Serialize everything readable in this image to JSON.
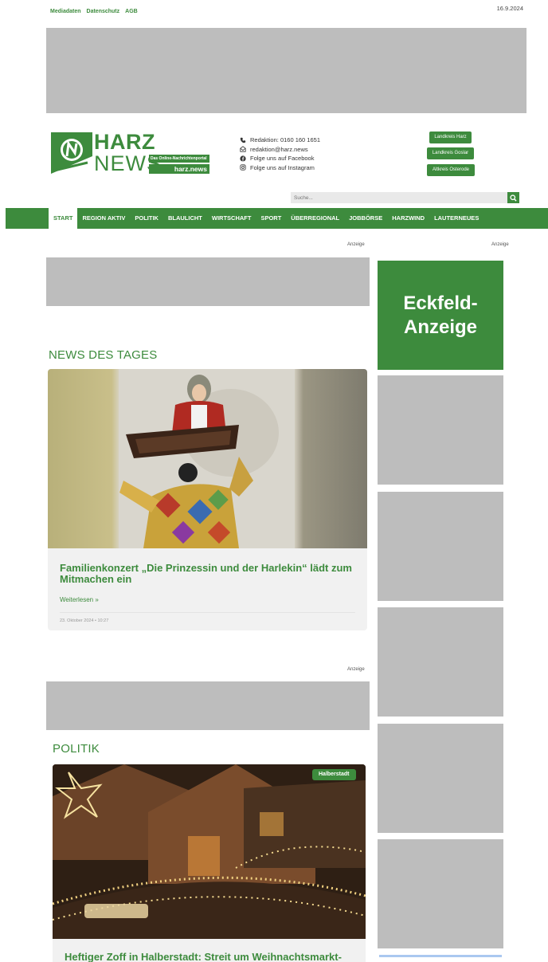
{
  "top_links": [
    "Mediadaten",
    "Datenschutz",
    "AGB"
  ],
  "date": "16.9.2024",
  "logo": {
    "harz": "HARZ",
    "news": "NEWS",
    "tagline": "Das Online-Nachrichtenportal",
    "url": "harz.news"
  },
  "contact": {
    "phone": "Redaktion: 0160 160 1651",
    "email": "redaktion@harz.news",
    "facebook": "Folge uns auf Facebook",
    "instagram": "Folge uns auf Instagram"
  },
  "districts": [
    "Landkreis Harz",
    "Landkreis Goslar",
    "Altkreis Osterode"
  ],
  "search": {
    "placeholder": "Suche..."
  },
  "nav": [
    "START",
    "REGION AKTIV",
    "POLITIK",
    "BLAULICHT",
    "WIRTSCHAFT",
    "SPORT",
    "ÜBERREGIONAL",
    "JOBBÖRSE",
    "HARZWIND",
    "LAUTERNEUES"
  ],
  "ad_label": "Anzeige",
  "eckfeld": "Eckfeld-\nAnzeige",
  "news_section": {
    "title": "NEWS DES TAGES",
    "headline": "Familienkonzert „Die Prinzessin und der Harlekin“ lädt zum Mitmachen ein",
    "more": "Weiterlesen »",
    "meta": "23. Oktober 2024  •  10:27"
  },
  "politik_section": {
    "title": "POLITIK",
    "badge": "Halberstadt",
    "headline": "Heftiger Zoff in Halberstadt: Streit um Weihnachtsmarkt-"
  },
  "colors": {
    "brand_green": "#3d8b3d",
    "ad_gray": "#bdbdbd"
  }
}
